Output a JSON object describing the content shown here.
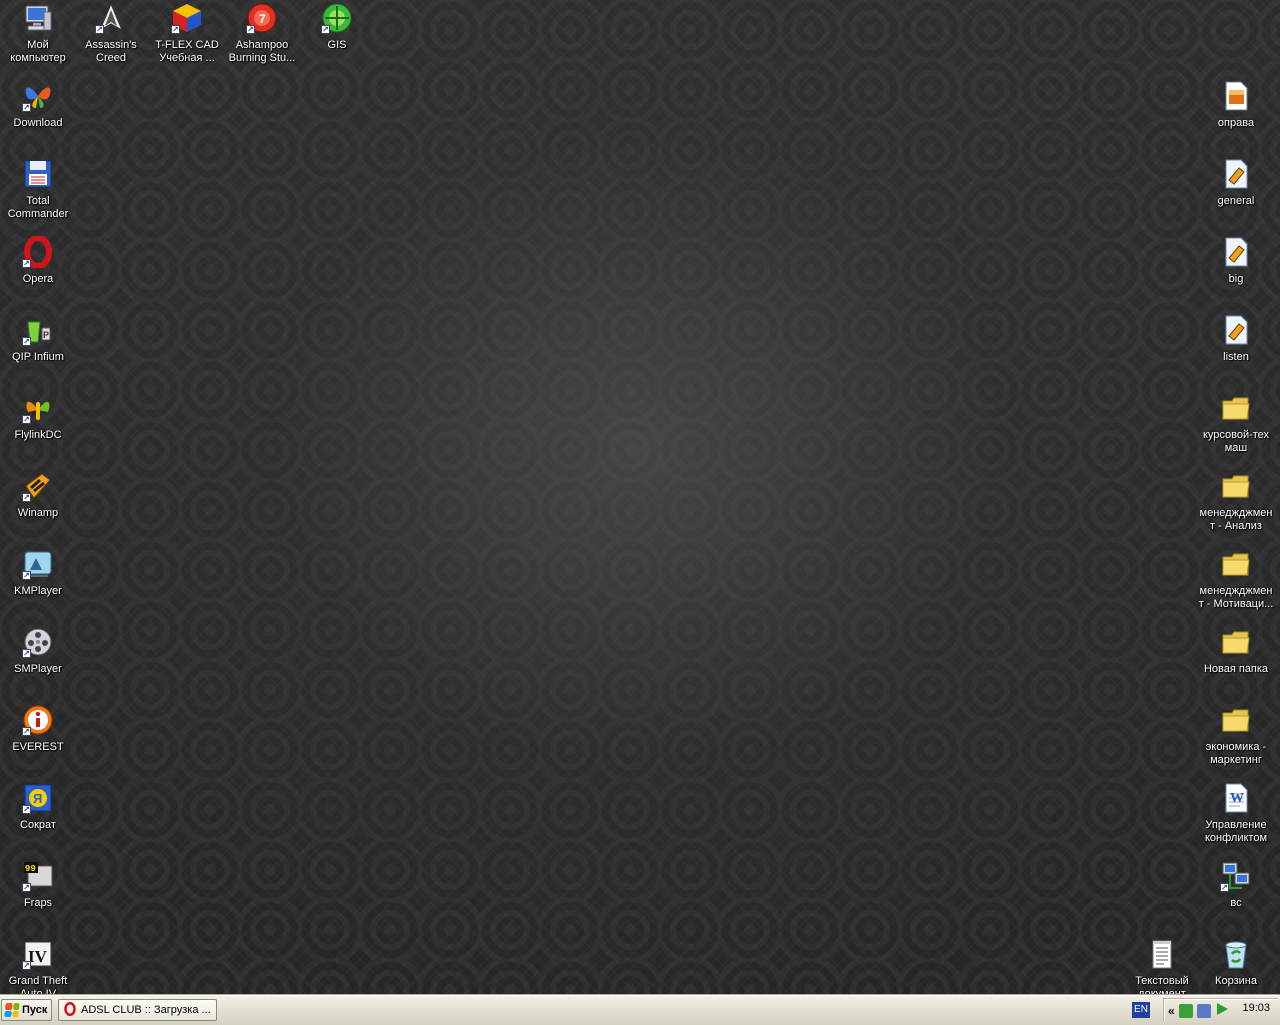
{
  "desktop": {
    "icons": [
      {
        "key": "my-computer",
        "label": "Мой компьютер",
        "shortcut": false
      },
      {
        "key": "assassins-creed",
        "label": "Assassin's Creed",
        "shortcut": true
      },
      {
        "key": "tflex",
        "label": "T-FLEX CAD Учебная ...",
        "shortcut": true
      },
      {
        "key": "ashampoo",
        "label": "Ashampoo Burning Stu...",
        "shortcut": true
      },
      {
        "key": "gis",
        "label": "GIS",
        "shortcut": true
      },
      {
        "key": "download",
        "label": "Download",
        "shortcut": true
      },
      {
        "key": "total-commander",
        "label": "Total Commander",
        "shortcut": false
      },
      {
        "key": "opera",
        "label": "Opera",
        "shortcut": true
      },
      {
        "key": "qip",
        "label": "QIP Infium",
        "shortcut": true
      },
      {
        "key": "flylinkdc",
        "label": "FlylinkDC",
        "shortcut": true
      },
      {
        "key": "winamp",
        "label": "Winamp",
        "shortcut": true
      },
      {
        "key": "kmplayer",
        "label": "KMPlayer",
        "shortcut": true
      },
      {
        "key": "smplayer",
        "label": "SMPlayer",
        "shortcut": true
      },
      {
        "key": "everest",
        "label": "EVEREST",
        "shortcut": true
      },
      {
        "key": "sokrat",
        "label": "Сократ",
        "shortcut": true
      },
      {
        "key": "fraps",
        "label": "Fraps",
        "shortcut": true
      },
      {
        "key": "gta4",
        "label": "Grand Theft Auto IV",
        "shortcut": true
      },
      {
        "key": "oprava",
        "label": "оправа",
        "shortcut": false
      },
      {
        "key": "general",
        "label": "general",
        "shortcut": false
      },
      {
        "key": "big",
        "label": "big",
        "shortcut": false
      },
      {
        "key": "listen",
        "label": "listen",
        "shortcut": false
      },
      {
        "key": "kursovoy",
        "label": "курсовой-тех маш",
        "shortcut": false
      },
      {
        "key": "management-analysis",
        "label": "менеджджмент - Анализ ри...",
        "shortcut": false
      },
      {
        "key": "management-motivation",
        "label": "менеджджмент - Мотиваци...",
        "shortcut": false
      },
      {
        "key": "new-folder",
        "label": "Новая папка",
        "shortcut": false
      },
      {
        "key": "economics",
        "label": "экономика - маркетинг",
        "shortcut": false
      },
      {
        "key": "conflict",
        "label": "Управление конфликтом",
        "shortcut": false
      },
      {
        "key": "vs",
        "label": "вс",
        "shortcut": false
      },
      {
        "key": "text-doc",
        "label": "Текстовый документ",
        "shortcut": false
      },
      {
        "key": "recycle-bin",
        "label": "Корзина",
        "shortcut": false
      }
    ]
  },
  "taskbar": {
    "start_label": "Пуск",
    "task_label": "ADSL CLUB :: Загрузка ...",
    "language": "EN",
    "tray_expand": "«",
    "clock": "19:03"
  },
  "colors": {
    "folder": "#f3d66a",
    "taskbar": "#e4e1d4",
    "lang_badge": "#1e3fa6"
  }
}
